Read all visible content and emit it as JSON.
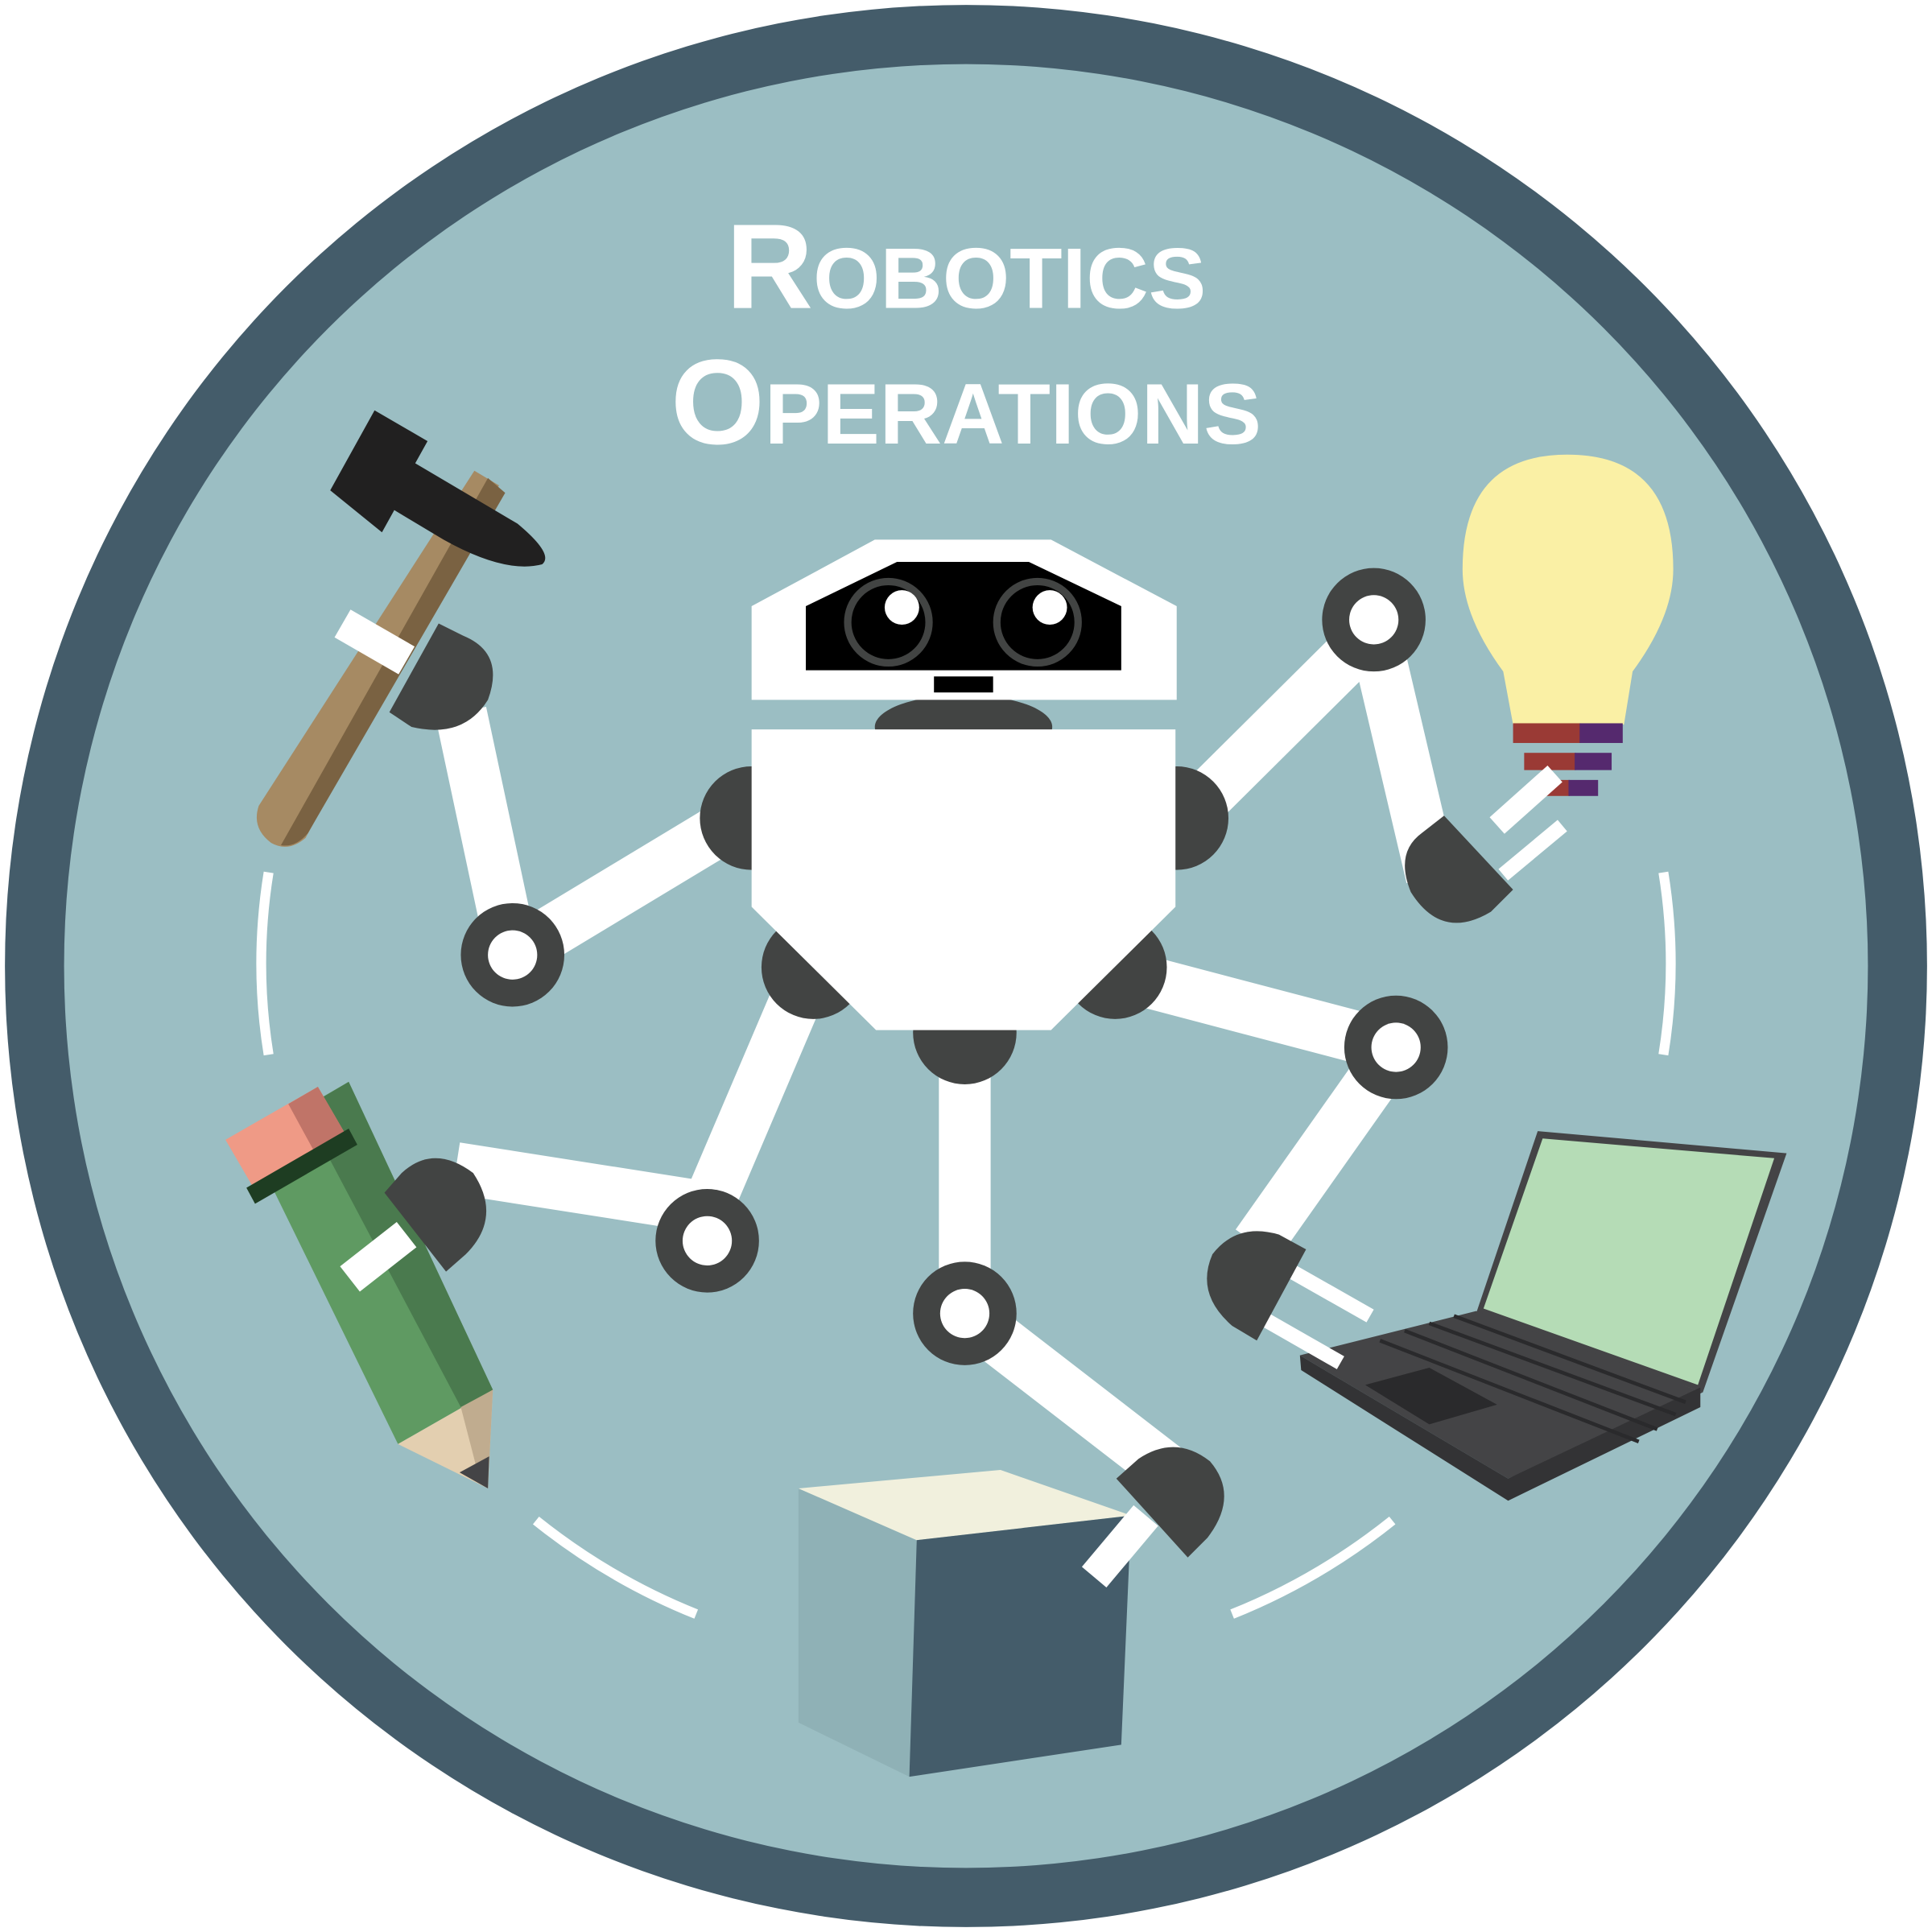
{
  "title": {
    "line1": {
      "initial": "R",
      "rest": "OBOTICS"
    },
    "line2": {
      "initial": "O",
      "rest": "PERATIONS"
    }
  },
  "colors": {
    "ring": "#445c6a",
    "background": "#9bbec3",
    "joint": "#424443",
    "arm": "#ffffff",
    "bulb": "#faf0a5",
    "bulb_base_red": "#9a3a35",
    "bulb_base_purple": "#55296e",
    "laptop_screen": "#b5dcb6",
    "laptop_body": "#444446",
    "pencil_body": "#5f9a62",
    "pencil_eraser": "#ef9a86",
    "hammer_handle": "#a68a63",
    "cube_top": "#f1f0dd",
    "cube_front": "#445c6a",
    "cube_side": "#8fb1b6"
  },
  "icons": [
    "robot-icon",
    "hammer-icon",
    "light-bulb-icon",
    "pencil-icon",
    "laptop-icon",
    "cube-icon"
  ]
}
